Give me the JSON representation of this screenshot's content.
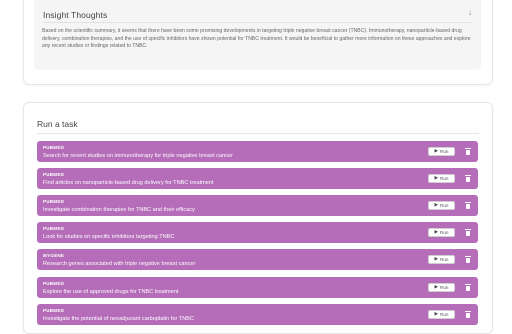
{
  "insight": {
    "title": "Insight Thoughts",
    "chevron_icon": "chevron-down-icon",
    "text": "Based on the scientific summary, it seems that there have been some promising developments in targeting triple negative breast cancer (TNBC). Immunotherapy, nanoparticle-based drug delivery, combination therapies, and the use of specific inhibitors have shown potential for TNBC treatment. It would be beneficial to gather more information on these approaches and explore any recent studies or findings related to TNBC."
  },
  "tasks": {
    "title": "Run a task",
    "run_label": "Run",
    "items": [
      {
        "source": "PUBMED",
        "description": "Search for recent studies on immunotherapy for triple negative breast cancer"
      },
      {
        "source": "PUBMED",
        "description": "Find articles on nanoparticle-based drug delivery for TNBC treatment"
      },
      {
        "source": "PUBMED",
        "description": "Investigate combination therapies for TNBC and their efficacy"
      },
      {
        "source": "PUBMED",
        "description": "Look for studies on specific inhibitors targeting TNBC"
      },
      {
        "source": "MYGENE",
        "description": "Research genes associated with triple negative breast cancer"
      },
      {
        "source": "PUBMED",
        "description": "Explore the use of approved drugs for TNBC treatment"
      },
      {
        "source": "PUBMED",
        "description": "Investigate the potential of neoadjuvant carboplatin for TNBC"
      }
    ]
  },
  "colors": {
    "task_bg": "#b56cb9",
    "insight_bg": "#f5f5f6"
  }
}
